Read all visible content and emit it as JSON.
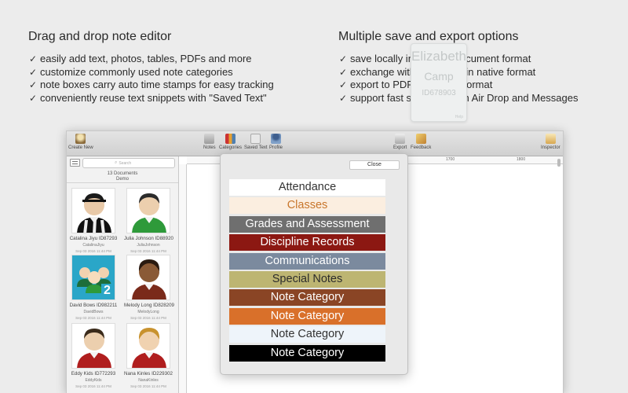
{
  "features": {
    "left": {
      "heading": "Drag and drop note editor",
      "items": [
        "easily add text, photos, tables, PDFs and more",
        "customize commonly used note categories",
        "note boxes carry auto time stamps for easy tracking",
        "conveniently reuse text snippets with  \"Saved Text\""
      ]
    },
    "right": {
      "heading": "Multiple save and export options",
      "items": [
        "save locally in \"profile\" document format",
        "exchange with co-editors in native format",
        "export to PDF document format",
        "support fast share through Air Drop and Messages"
      ]
    },
    "check_glyph": "✓"
  },
  "toolbar": {
    "create_new": "Create New",
    "notes": "Notes",
    "categories": "Categories",
    "saved_text": "Saved Text",
    "profile": "Profile",
    "export": "Export",
    "feedback": "Feedback",
    "inspector": "Inspector"
  },
  "sidebar": {
    "search_placeholder": "Search",
    "doc_count": "13 Documents",
    "folder": "Demo",
    "tiles": [
      {
        "name": "Catalina Jiyu ID87293",
        "user": "CatalinaJiyu",
        "date": "Sep 03 2016 11:44 PM",
        "kind": "referee-icon"
      },
      {
        "name": "Julia Johnson ID88920",
        "user": "JuliaJohnson",
        "date": "Sep 03 2016 11:44 PM",
        "kind": "student-green-icon"
      },
      {
        "name": "David Bows ID982211",
        "user": "DavidBows",
        "date": "Sep 03 2016 11:44 PM",
        "kind": "group-icon",
        "badge": "2"
      },
      {
        "name": "Melody Long ID828209",
        "user": "MelodyLong",
        "date": "Sep 03 2016 11:44 PM",
        "kind": "student-dark-icon"
      },
      {
        "name": "Eddy Kids ID772293",
        "user": "EddyKids",
        "date": "Sep 03 2016 11:44 PM",
        "kind": "student-red-icon"
      },
      {
        "name": "Nana Kinles ID229302",
        "user": "NanaKinles",
        "date": "Sep 03 2016 11:44 PM",
        "kind": "student-red-blond-icon"
      }
    ]
  },
  "ruler": {
    "marks": [
      "1700",
      "1800"
    ]
  },
  "note_box": {
    "first": "Elizabeth",
    "last": "Camp",
    "id": "ID678903",
    "footer": "Help"
  },
  "popover": {
    "close": "Close",
    "categories": [
      {
        "label": "Attendance",
        "bg": "#ffffff",
        "fg": "#333333"
      },
      {
        "label": "Classes",
        "bg": "#fbeee0",
        "fg": "#c8762c"
      },
      {
        "label": "Grades and Assessment",
        "bg": "#6f6f6f",
        "fg": "#ffffff"
      },
      {
        "label": "Discipline Records",
        "bg": "#8c1812",
        "fg": "#ffffff"
      },
      {
        "label": "Communications",
        "bg": "#7b8a9e",
        "fg": "#ffffff"
      },
      {
        "label": "Special Notes",
        "bg": "#bdb572",
        "fg": "#2c2c2c"
      },
      {
        "label": "Note Category",
        "bg": "#8a4525",
        "fg": "#ffffff"
      },
      {
        "label": "Note Category",
        "bg": "#d9702a",
        "fg": "#ffffff"
      },
      {
        "label": "Note Category",
        "bg": "#eef4fa",
        "fg": "#333333"
      },
      {
        "label": "Note Category",
        "bg": "#000000",
        "fg": "#ffffff"
      }
    ]
  }
}
